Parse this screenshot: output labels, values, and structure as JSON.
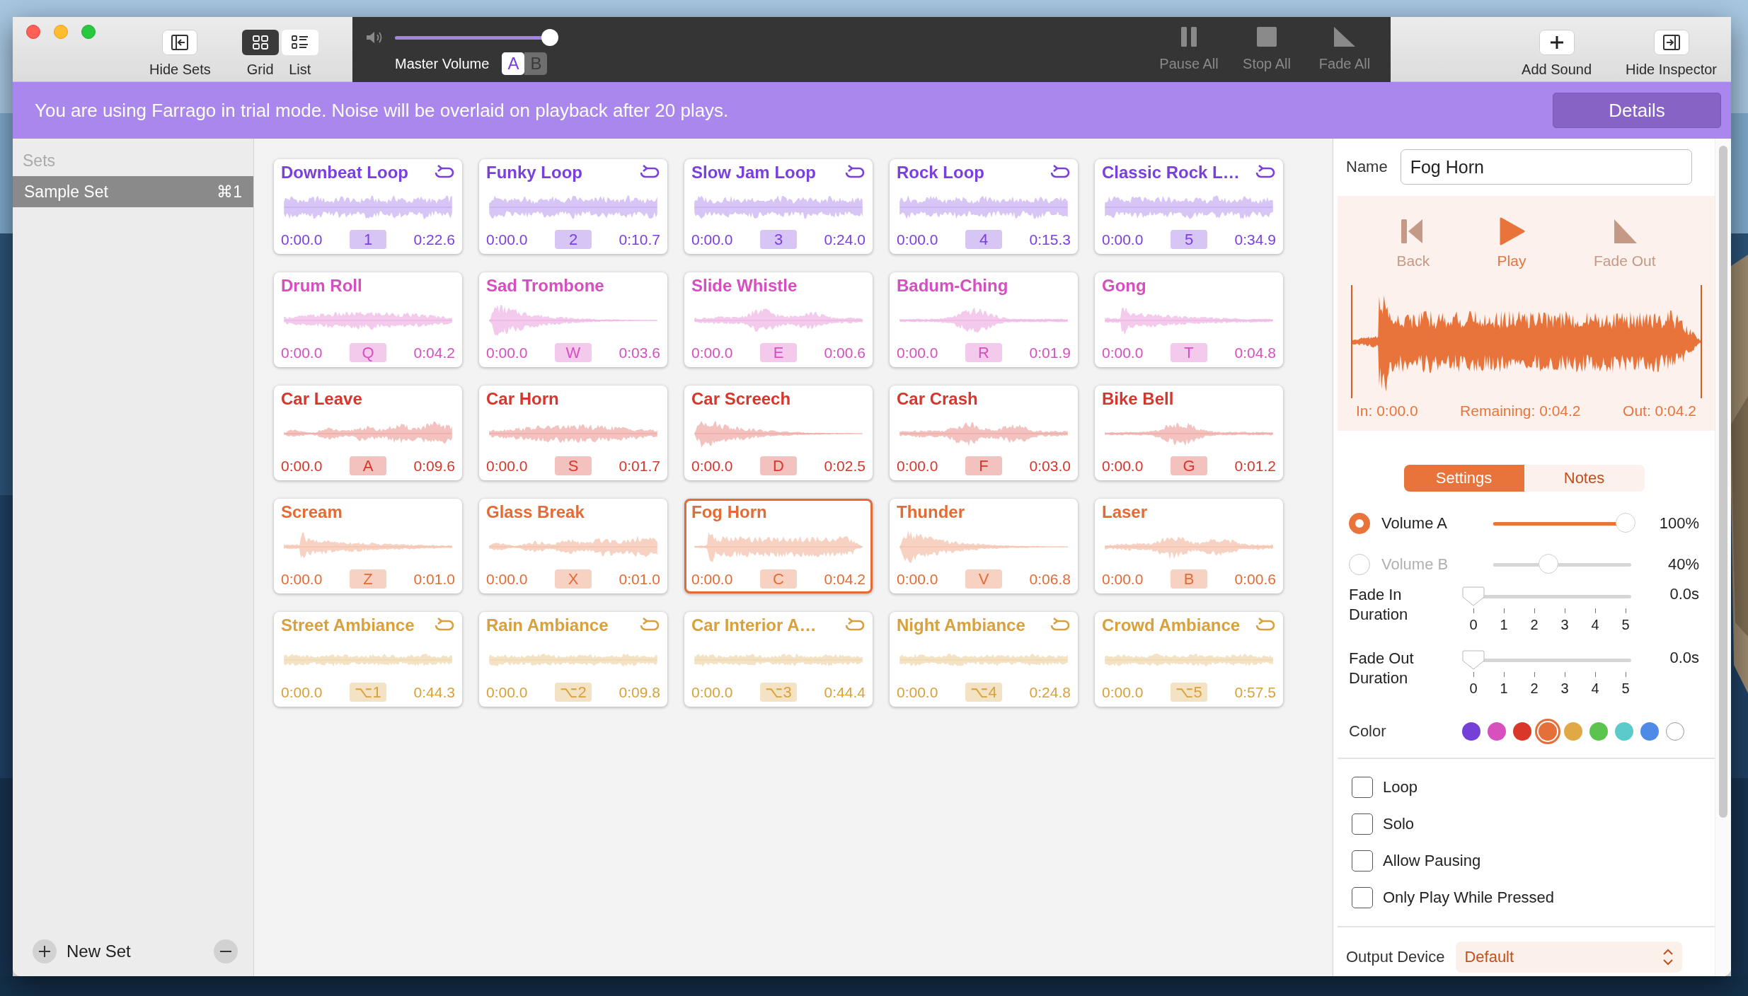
{
  "toolbar": {
    "hide_sets": {
      "label": "Hide Sets"
    },
    "view_modes": [
      {
        "label": "Grid",
        "kind": "grid",
        "selected": true
      },
      {
        "label": "List",
        "kind": "list",
        "selected": false
      }
    ],
    "master_volume": {
      "label": "Master Volume",
      "level": 1.0,
      "banks": [
        {
          "label": "A",
          "selected": true
        },
        {
          "label": "B",
          "selected": false
        }
      ]
    },
    "transport": [
      {
        "label": "Pause All",
        "kind": "pause",
        "disabled": true
      },
      {
        "label": "Stop All",
        "kind": "stop",
        "disabled": true
      },
      {
        "label": "Fade All",
        "kind": "fade",
        "disabled": true
      }
    ],
    "right_items": [
      {
        "label": "Add Sound",
        "kind": "add"
      },
      {
        "label": "Hide Inspector",
        "kind": "inspector"
      }
    ]
  },
  "banner": {
    "message": "You are using Farrago in trial mode. Noise will be overlaid on playback after 20 plays.",
    "button": "Details"
  },
  "sidebar": {
    "header": "Sets",
    "items": [
      {
        "label": "Sample Set",
        "shortcut": "⌘1",
        "selected": true
      }
    ],
    "add_label": "New Set"
  },
  "sounds": [
    {
      "name": "Downbeat Loop",
      "loop": true,
      "start": "0:00.0",
      "key": "1",
      "end": "0:22.6",
      "color": "#7a3fdf",
      "selected": false
    },
    {
      "name": "Funky Loop",
      "loop": true,
      "start": "0:00.0",
      "key": "2",
      "end": "0:10.7",
      "color": "#7a3fdf",
      "selected": false
    },
    {
      "name": "Slow Jam Loop",
      "loop": true,
      "start": "0:00.0",
      "key": "3",
      "end": "0:24.0",
      "color": "#7a3fdf",
      "selected": false
    },
    {
      "name": "Rock Loop",
      "loop": true,
      "start": "0:00.0",
      "key": "4",
      "end": "0:15.3",
      "color": "#7a3fdf",
      "selected": false
    },
    {
      "name": "Classic Rock L…",
      "loop": true,
      "start": "0:00.0",
      "key": "5",
      "end": "0:34.9",
      "color": "#7a3fdf",
      "selected": false
    },
    {
      "name": "Drum Roll",
      "loop": false,
      "start": "0:00.0",
      "key": "Q",
      "end": "0:04.2",
      "color": "#d64fc1",
      "selected": false
    },
    {
      "name": "Sad Trombone",
      "loop": false,
      "start": "0:00.0",
      "key": "W",
      "end": "0:03.6",
      "color": "#d64fc1",
      "selected": false
    },
    {
      "name": "Slide Whistle",
      "loop": false,
      "start": "0:00.0",
      "key": "E",
      "end": "0:00.6",
      "color": "#d64fc1",
      "selected": false
    },
    {
      "name": "Badum-Ching",
      "loop": false,
      "start": "0:00.0",
      "key": "R",
      "end": "0:01.9",
      "color": "#d64fc1",
      "selected": false
    },
    {
      "name": "Gong",
      "loop": false,
      "start": "0:00.0",
      "key": "T",
      "end": "0:04.8",
      "color": "#d64fc1",
      "selected": false
    },
    {
      "name": "Car Leave",
      "loop": false,
      "start": "0:00.0",
      "key": "A",
      "end": "0:09.6",
      "color": "#d7362c",
      "selected": false
    },
    {
      "name": "Car Horn",
      "loop": false,
      "start": "0:00.0",
      "key": "S",
      "end": "0:01.7",
      "color": "#d7362c",
      "selected": false
    },
    {
      "name": "Car Screech",
      "loop": false,
      "start": "0:00.0",
      "key": "D",
      "end": "0:02.5",
      "color": "#d7362c",
      "selected": false
    },
    {
      "name": "Car Crash",
      "loop": false,
      "start": "0:00.0",
      "key": "F",
      "end": "0:03.0",
      "color": "#d7362c",
      "selected": false
    },
    {
      "name": "Bike Bell",
      "loop": false,
      "start": "0:00.0",
      "key": "G",
      "end": "0:01.2",
      "color": "#d7362c",
      "selected": false
    },
    {
      "name": "Scream",
      "loop": false,
      "start": "0:00.0",
      "key": "Z",
      "end": "0:01.0",
      "color": "#e46b36",
      "selected": false
    },
    {
      "name": "Glass Break",
      "loop": false,
      "start": "0:00.0",
      "key": "X",
      "end": "0:01.0",
      "color": "#e46b36",
      "selected": false
    },
    {
      "name": "Fog Horn",
      "loop": false,
      "start": "0:00.0",
      "key": "C",
      "end": "0:04.2",
      "color": "#e46b36",
      "selected": true
    },
    {
      "name": "Thunder",
      "loop": false,
      "start": "0:00.0",
      "key": "V",
      "end": "0:06.8",
      "color": "#e46b36",
      "selected": false
    },
    {
      "name": "Laser",
      "loop": false,
      "start": "0:00.0",
      "key": "B",
      "end": "0:00.6",
      "color": "#e46b36",
      "selected": false
    },
    {
      "name": "Street Ambiance",
      "loop": true,
      "start": "0:00.0",
      "key": "⌥1",
      "end": "0:44.3",
      "color": "#d9a03c",
      "selected": false
    },
    {
      "name": "Rain Ambiance",
      "loop": true,
      "start": "0:00.0",
      "key": "⌥2",
      "end": "0:09.8",
      "color": "#d9a03c",
      "selected": false
    },
    {
      "name": "Car Interior A…",
      "loop": true,
      "start": "0:00.0",
      "key": "⌥3",
      "end": "0:44.4",
      "color": "#d9a03c",
      "selected": false
    },
    {
      "name": "Night Ambiance",
      "loop": true,
      "start": "0:00.0",
      "key": "⌥4",
      "end": "0:24.8",
      "color": "#d9a03c",
      "selected": false
    },
    {
      "name": "Crowd Ambiance",
      "loop": true,
      "start": "0:00.0",
      "key": "⌥5",
      "end": "0:57.5",
      "color": "#d9a03c",
      "selected": false
    }
  ],
  "inspector": {
    "name_label": "Name",
    "name_value": "Fog Horn",
    "controls": [
      {
        "label": "Back",
        "kind": "back",
        "disabled": true
      },
      {
        "label": "Play",
        "kind": "play",
        "disabled": false
      },
      {
        "label": "Fade Out",
        "kind": "fade",
        "disabled": true
      }
    ],
    "times": [
      "In: 0:00.0",
      "Remaining: 0:04.2",
      "Out: 0:04.2"
    ],
    "tabs": [
      {
        "label": "Settings",
        "selected": true
      },
      {
        "label": "Notes",
        "selected": false
      }
    ],
    "volumes": [
      {
        "label": "Volume A",
        "selected": true,
        "level": 1.0,
        "reading": "100%"
      },
      {
        "label": "Volume B",
        "selected": false,
        "level": 0.4,
        "reading": "40%"
      }
    ],
    "fades": [
      {
        "label": "Fade In Duration",
        "level": 0,
        "reading": "0.0s",
        "ticks": [
          "0",
          "1",
          "2",
          "3",
          "4",
          "5"
        ]
      },
      {
        "label": "Fade Out Duration",
        "level": 0,
        "reading": "0.0s",
        "ticks": [
          "0",
          "1",
          "2",
          "3",
          "4",
          "5"
        ]
      }
    ],
    "color_label": "Color",
    "colors": [
      {
        "color": "#7440d8",
        "selected": false
      },
      {
        "color": "#d84fbe",
        "selected": false
      },
      {
        "color": "#d9372a",
        "selected": false
      },
      {
        "color": "#e46f38",
        "selected": true
      },
      {
        "color": "#e1a846",
        "selected": false
      },
      {
        "color": "#5bc44f",
        "selected": false
      },
      {
        "color": "#5ccaca",
        "selected": false
      },
      {
        "color": "#4d8be6",
        "selected": false
      },
      {
        "color": "#ffffff",
        "selected": false
      }
    ],
    "options": [
      {
        "label": "Loop",
        "checked": false
      },
      {
        "label": "Solo",
        "checked": false
      },
      {
        "label": "Allow Pausing",
        "checked": false
      },
      {
        "label": "Only Play While Pressed",
        "checked": false
      }
    ],
    "output_label": "Output Device",
    "output_value": "Default"
  }
}
